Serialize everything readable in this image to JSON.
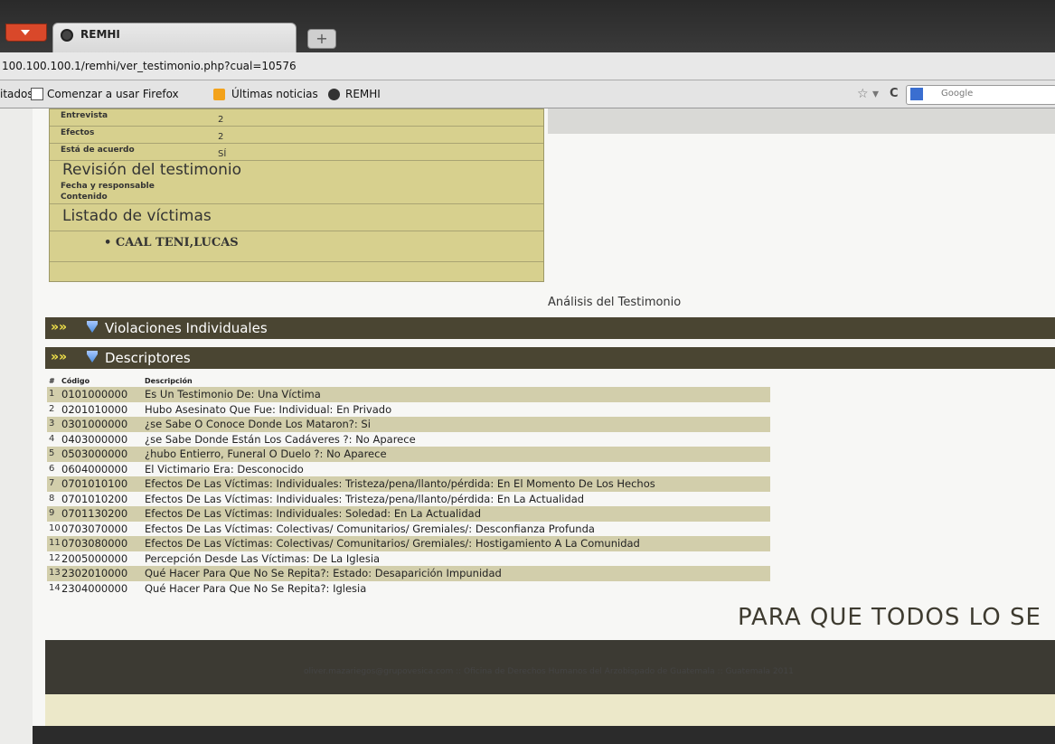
{
  "browser": {
    "tab_title": "REMHI",
    "new_tab": "+",
    "url": "100.100.100.1/remhi/ver_testimonio.php?cual=10576",
    "bookmarks": [
      {
        "label": "itados"
      },
      {
        "label": "Comenzar a usar Firefox"
      },
      {
        "label": "Últimas noticias"
      },
      {
        "label": "REMHI"
      }
    ],
    "star": "☆ ▾",
    "reload": "C",
    "search_placeholder": "Google"
  },
  "info": {
    "rows": [
      {
        "label": "Entrevista",
        "value": "2"
      },
      {
        "label": "Efectos",
        "value": "2"
      },
      {
        "label": "Está de acuerdo",
        "value": "SÍ"
      }
    ],
    "revision_heading": "Revisión del testimonio",
    "revision_rows": [
      "Fecha y responsable",
      "Contenido"
    ],
    "victims_heading": "Listado de víctimas",
    "victims": [
      "CAAL TENI,LUCAS"
    ]
  },
  "analisis": {
    "title": "Análisis del Testimonio",
    "sections": [
      {
        "label": "Violaciones Individuales"
      },
      {
        "label": "Descriptores"
      }
    ]
  },
  "descriptores": {
    "headers": {
      "num": "#",
      "code": "Código",
      "desc": "Descripción"
    },
    "rows": [
      {
        "num": "1",
        "code": "0101000000",
        "desc": "Es Un Testimonio De: Una Víctima"
      },
      {
        "num": "2",
        "code": "0201010000",
        "desc": "Hubo Asesinato Que Fue: Individual: En Privado"
      },
      {
        "num": "3",
        "code": "0301000000",
        "desc": "¿se Sabe O Conoce Donde Los Mataron?: Si"
      },
      {
        "num": "4",
        "code": "0403000000",
        "desc": "¿se Sabe Donde Están Los Cadáveres ?: No Aparece"
      },
      {
        "num": "5",
        "code": "0503000000",
        "desc": "¿hubo Entierro, Funeral O Duelo ?: No Aparece"
      },
      {
        "num": "6",
        "code": "0604000000",
        "desc": "El Victimario Era: Desconocido"
      },
      {
        "num": "7",
        "code": "0701010100",
        "desc": "Efectos De Las Víctimas: Individuales: Tristeza/pena/llanto/pérdida: En El Momento De Los Hechos"
      },
      {
        "num": "8",
        "code": "0701010200",
        "desc": "Efectos De Las Víctimas: Individuales: Tristeza/pena/llanto/pérdida: En La Actualidad"
      },
      {
        "num": "9",
        "code": "0701130200",
        "desc": "Efectos De Las Víctimas: Individuales: Soledad: En La Actualidad"
      },
      {
        "num": "10",
        "code": "0703070000",
        "desc": "Efectos De Las Víctimas: Colectivas/ Comunitarios/ Gremiales/: Desconfianza Profunda"
      },
      {
        "num": "11",
        "code": "0703080000",
        "desc": "Efectos De Las Víctimas: Colectivas/ Comunitarios/ Gremiales/: Hostigamiento A La Comunidad"
      },
      {
        "num": "12",
        "code": "2005000000",
        "desc": "Percepción Desde Las Víctimas: De La Iglesia"
      },
      {
        "num": "13",
        "code": "2302010000",
        "desc": "Qué Hacer Para Que No Se Repita?: Estado: Desaparición Impunidad"
      },
      {
        "num": "14",
        "code": "2304000000",
        "desc": "Qué Hacer Para Que No Se Repita?: Iglesia"
      }
    ]
  },
  "footer": {
    "slogan": "PARA QUE TODOS LO SE",
    "text": "oliver.mazariegos@grupovesica.com :: Oficina de Derechos Humanos del Arzobispado de Guatemala :: Guatemala 2011"
  }
}
